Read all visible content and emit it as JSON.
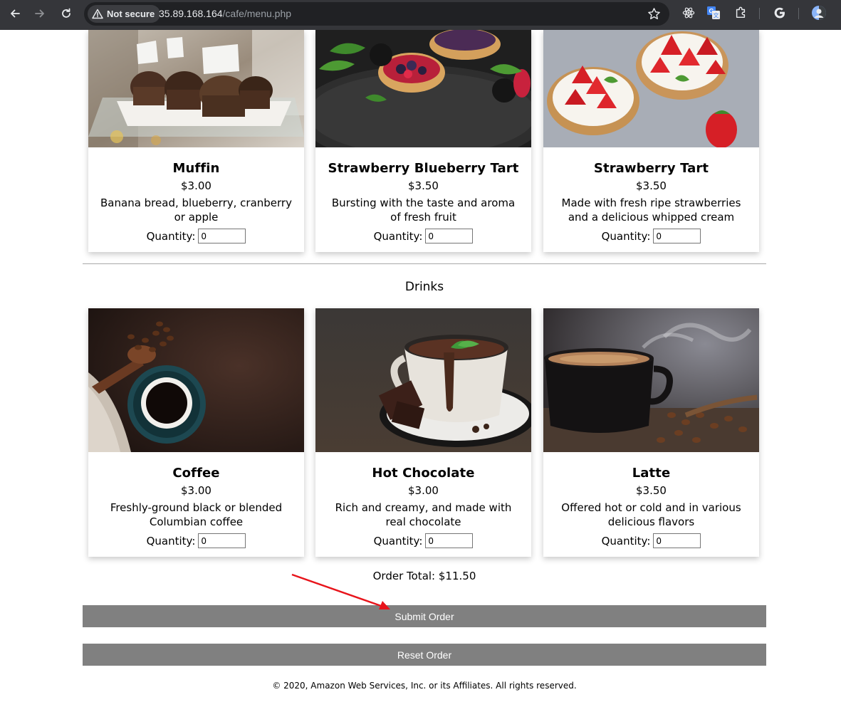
{
  "browser": {
    "security_label": "Not secure",
    "url_host": "35.89.168.164",
    "url_path": "/cafe/menu.php",
    "icons": [
      "back-icon",
      "forward-icon",
      "reload-icon",
      "warning-icon",
      "star-icon",
      "react-devtools-icon",
      "translate-icon",
      "extensions-icon",
      "google-icon",
      "profile-avatar-icon"
    ]
  },
  "pastries": [
    {
      "name": "Muffin",
      "price": "$3.00",
      "description": "Banana bread, blueberry, cranberry or apple",
      "quantity_label": "Quantity:",
      "quantity": "0"
    },
    {
      "name": "Strawberry Blueberry Tart",
      "price": "$3.50",
      "description": "Bursting with the taste and aroma of fresh fruit",
      "quantity_label": "Quantity:",
      "quantity": "0"
    },
    {
      "name": "Strawberry Tart",
      "price": "$3.50",
      "description": "Made with fresh ripe strawberries and a delicious whipped cream",
      "quantity_label": "Quantity:",
      "quantity": "0"
    }
  ],
  "drinks_heading": "Drinks",
  "drinks": [
    {
      "name": "Coffee",
      "price": "$3.00",
      "description": "Freshly-ground black or blended Columbian coffee",
      "quantity_label": "Quantity:",
      "quantity": "0"
    },
    {
      "name": "Hot Chocolate",
      "price": "$3.00",
      "description": "Rich and creamy, and made with real chocolate",
      "quantity_label": "Quantity:",
      "quantity": "0"
    },
    {
      "name": "Latte",
      "price": "$3.50",
      "description": "Offered hot or cold and in various delicious flavors",
      "quantity_label": "Quantity:",
      "quantity": "0"
    }
  ],
  "order_total": "Order Total: $11.50",
  "submit_label": "Submit Order",
  "reset_label": "Reset Order",
  "footer": "© 2020, Amazon Web Services, Inc. or its Affiliates. All rights reserved.",
  "colors": {
    "button_bg": "#808080",
    "annotation_arrow": "#e8141b",
    "chrome_bg": "#35363a"
  }
}
